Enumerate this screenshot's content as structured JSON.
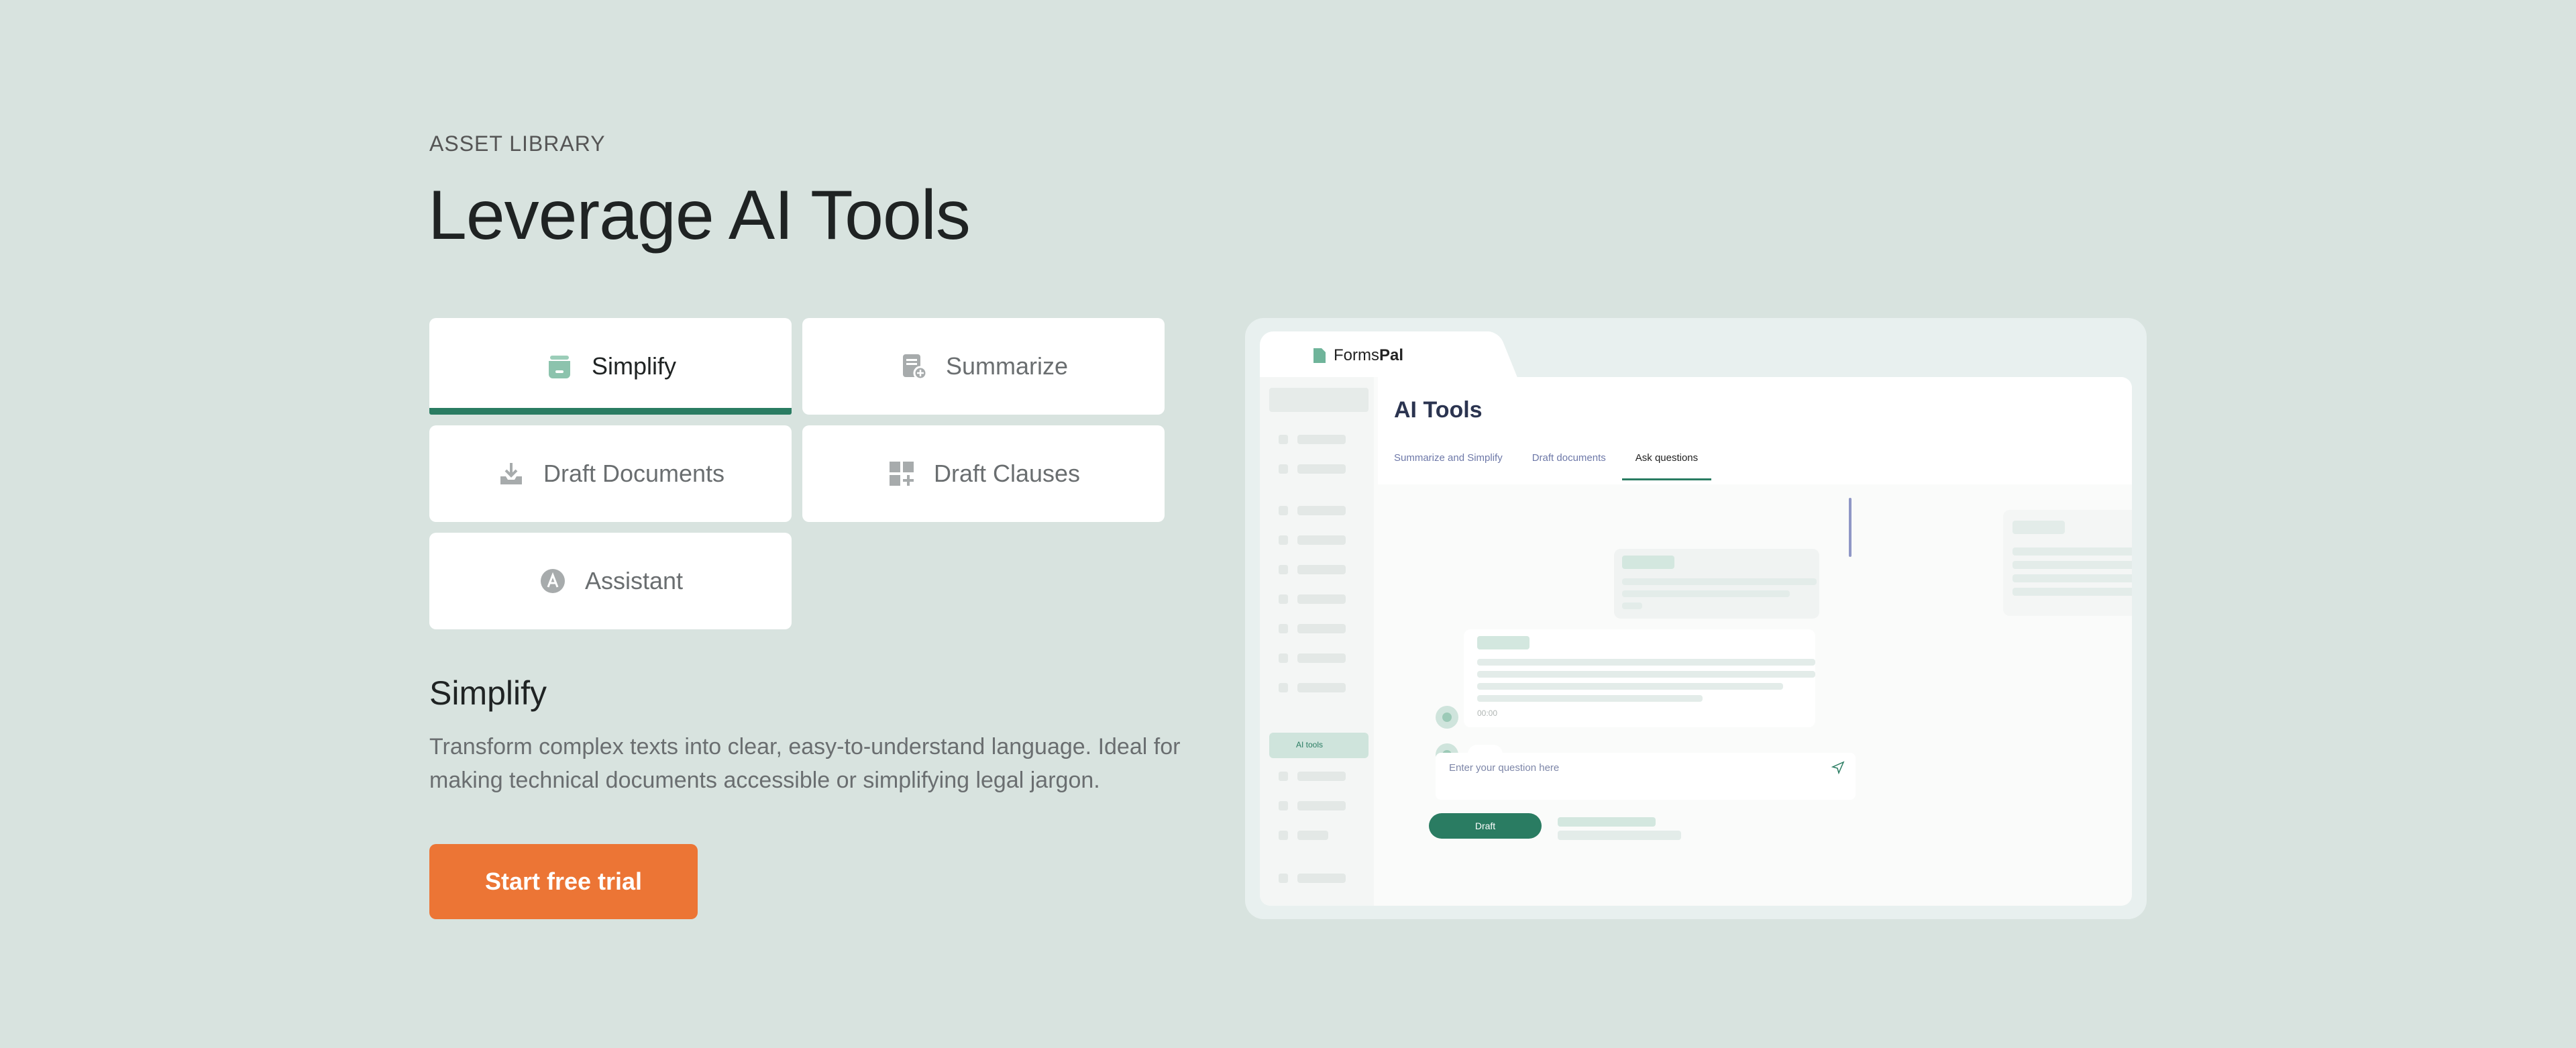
{
  "section_label": "ASSET LIBRARY",
  "headline": "Leverage AI Tools",
  "tabs": [
    {
      "label": "Simplify",
      "icon": "archive-icon",
      "active": true
    },
    {
      "label": "Summarize",
      "icon": "document-gear-icon",
      "active": false
    },
    {
      "label": "Draft Documents",
      "icon": "download-tray-icon",
      "active": false
    },
    {
      "label": "Draft Clauses",
      "icon": "grid-plus-icon",
      "active": false
    },
    {
      "label": "Assistant",
      "icon": "assistant-a-icon",
      "active": false
    }
  ],
  "detail": {
    "title": "Simplify",
    "description": "Transform complex texts into clear, easy-to-understand language. Ideal for making technical documents accessible or simplifying legal jargon."
  },
  "cta_label": "Start free trial",
  "preview": {
    "brand_prefix": "Forms",
    "brand_suffix": "Pal",
    "sidebar_active": "AI tools",
    "title": "AI Tools",
    "subtabs": [
      "Summarize and Simplify",
      "Draft documents",
      "Ask questions"
    ],
    "active_subtab": "Ask questions",
    "input_placeholder": "Enter your question here",
    "draft_label": "Draft",
    "message_time": "00:00"
  },
  "colors": {
    "background": "#d8e3df",
    "accent_green": "#2a7c62",
    "cta_orange": "#ec7535"
  }
}
